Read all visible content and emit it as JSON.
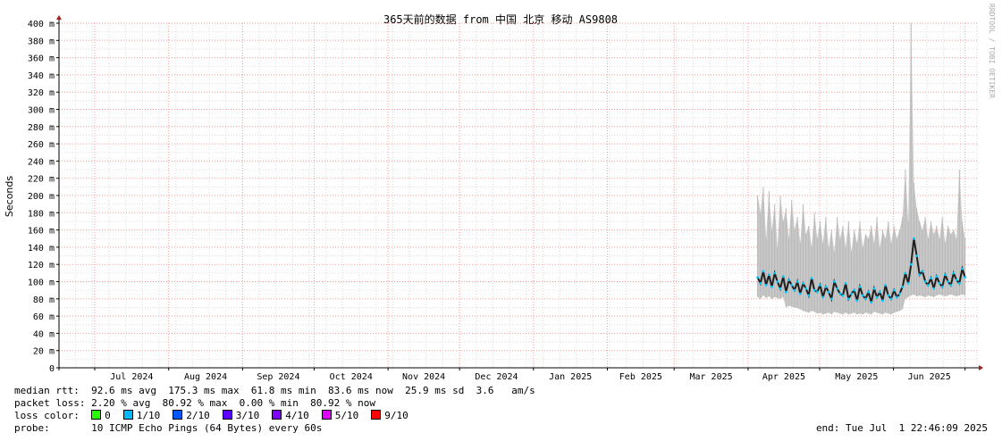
{
  "chart_data": {
    "type": "area",
    "title": "365天前的数据 from 中国 北京 移动 AS9808",
    "ylabel": "Seconds",
    "xlabel": "",
    "ylim": [
      0,
      0.4
    ],
    "yticks": [
      {
        "v": 0,
        "label": "0"
      },
      {
        "v": 20,
        "label": "20 m"
      },
      {
        "v": 40,
        "label": "40 m"
      },
      {
        "v": 60,
        "label": "60 m"
      },
      {
        "v": 80,
        "label": "80 m"
      },
      {
        "v": 100,
        "label": "100 m"
      },
      {
        "v": 120,
        "label": "120 m"
      },
      {
        "v": 140,
        "label": "140 m"
      },
      {
        "v": 160,
        "label": "160 m"
      },
      {
        "v": 180,
        "label": "180 m"
      },
      {
        "v": 200,
        "label": "200 m"
      },
      {
        "v": 220,
        "label": "220 m"
      },
      {
        "v": 240,
        "label": "240 m"
      },
      {
        "v": 260,
        "label": "260 m"
      },
      {
        "v": 280,
        "label": "280 m"
      },
      {
        "v": 300,
        "label": "300 m"
      },
      {
        "v": 320,
        "label": "320 m"
      },
      {
        "v": 340,
        "label": "340 m"
      },
      {
        "v": 360,
        "label": "360 m"
      },
      {
        "v": 380,
        "label": "380 m"
      },
      {
        "v": 400,
        "label": "400 m"
      }
    ],
    "xlim": [
      "2024-06-16",
      "2025-07-06"
    ],
    "month_ticks": [
      {
        "date": "2024-06-01",
        "label": ""
      },
      {
        "date": "2024-07-01",
        "label": "Jul 2024"
      },
      {
        "date": "2024-08-01",
        "label": "Aug 2024"
      },
      {
        "date": "2024-09-01",
        "label": "Sep 2024"
      },
      {
        "date": "2024-10-01",
        "label": "Oct 2024"
      },
      {
        "date": "2024-11-01",
        "label": "Nov 2024"
      },
      {
        "date": "2024-12-01",
        "label": "Dec 2024"
      },
      {
        "date": "2025-01-01",
        "label": "Jan 2025"
      },
      {
        "date": "2025-02-01",
        "label": "Feb 2025"
      },
      {
        "date": "2025-03-01",
        "label": "Mar 2025"
      },
      {
        "date": "2025-04-01",
        "label": "Apr 2025"
      },
      {
        "date": "2025-05-01",
        "label": "May 2025"
      },
      {
        "date": "2025-06-01",
        "label": "Jun 2025"
      },
      {
        "date": "2025-07-01",
        "label": ""
      }
    ],
    "data_start": "2025-04-05",
    "data_end": "2025-07-01",
    "series": [
      {
        "key": "median",
        "values_ms": [
          105,
          98,
          112,
          96,
          108,
          94,
          110,
          100,
          92,
          106,
          88,
          102,
          96,
          90,
          100,
          86,
          98,
          92,
          84,
          104,
          90,
          88,
          96,
          82,
          94,
          88,
          80,
          100,
          92,
          86,
          84,
          98,
          80,
          86,
          90,
          78,
          94,
          84,
          80,
          88,
          76,
          92,
          82,
          88,
          78,
          96,
          84,
          80,
          90,
          82,
          86,
          94,
          110,
          98,
          120,
          150,
          130,
          108,
          112,
          100,
          96,
          104,
          92,
          106,
          98,
          94,
          108,
          100,
          96,
          110,
          102,
          98,
          115,
          105
        ]
      },
      {
        "key": "min",
        "values_ms": [
          82,
          80,
          84,
          81,
          83,
          80,
          82,
          81,
          80,
          82,
          70,
          72,
          71,
          70,
          69,
          68,
          66,
          65,
          64,
          66,
          65,
          63,
          64,
          62,
          63,
          64,
          62,
          65,
          64,
          63,
          62,
          64,
          62,
          63,
          64,
          62,
          63,
          62,
          64,
          63,
          62,
          65,
          64,
          63,
          62,
          64,
          63,
          62,
          64,
          65,
          66,
          68,
          80,
          82,
          84,
          85,
          83,
          84,
          83,
          82,
          84,
          83,
          82,
          84,
          85,
          84,
          83,
          84,
          85,
          84,
          83,
          84,
          85,
          84
        ]
      },
      {
        "key": "max",
        "values_ms": [
          200,
          180,
          210,
          150,
          205,
          160,
          190,
          140,
          200,
          170,
          185,
          150,
          195,
          160,
          175,
          145,
          190,
          155,
          165,
          140,
          180,
          150,
          170,
          145,
          175,
          140,
          160,
          135,
          175,
          150,
          165,
          140,
          170,
          135,
          160,
          145,
          170,
          140,
          155,
          150,
          165,
          145,
          175,
          140,
          160,
          150,
          170,
          145,
          165,
          150,
          160,
          175,
          230,
          170,
          400,
          215,
          185,
          170,
          160,
          175,
          150,
          170,
          155,
          165,
          150,
          175,
          145,
          165,
          155,
          160,
          150,
          230,
          170,
          150
        ]
      }
    ],
    "colors": {
      "median": "#202020",
      "smoke": "#c8c8c8",
      "grid_minor": "#dddddd",
      "grid_major": "#ff9999",
      "axis": "#000000",
      "arrow": "#a02020",
      "loss_dot": "#00c8ff"
    }
  },
  "stats": {
    "median_rtt_label": "median rtt:",
    "median_rtt_values": "92.6 ms avg  175.3 ms max  61.8 ms min  83.6 ms now  25.9 ms sd  3.6   am/s",
    "packet_loss_label": "packet loss:",
    "packet_loss_values": "2.20 % avg  80.92 % max  0.00 % min  80.92 % now",
    "loss_color_label": "loss color:",
    "loss_colors": [
      {
        "label": "0",
        "color": "#26ff00"
      },
      {
        "label": "1/10",
        "color": "#00b8ff"
      },
      {
        "label": "2/10",
        "color": "#0059ff"
      },
      {
        "label": "3/10",
        "color": "#5e00ff"
      },
      {
        "label": "4/10",
        "color": "#7e00ff"
      },
      {
        "label": "5/10",
        "color": "#dd00ff"
      },
      {
        "label": "9/10",
        "color": "#ff0000"
      }
    ],
    "probe_label": "probe:",
    "probe_value": "10 ICMP Echo Pings (64 Bytes) every 60s",
    "end_label": "end: Tue Jul  1 22:46:09 2025"
  },
  "watermark": "RRDTOOL / TOBI OETIKER"
}
